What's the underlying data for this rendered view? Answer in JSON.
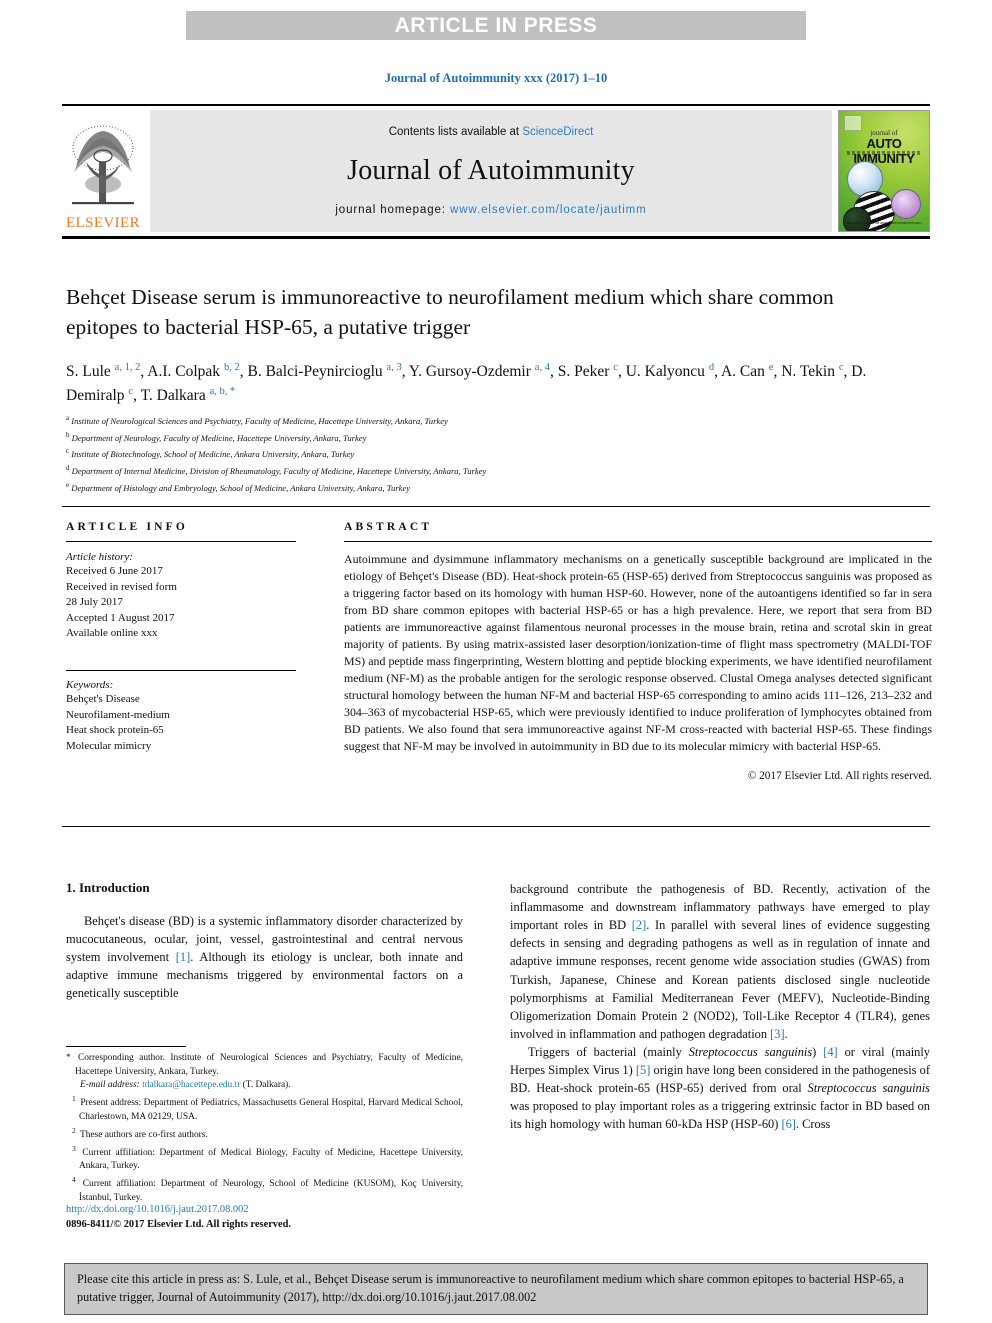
{
  "banner": {
    "text": "ARTICLE IN PRESS"
  },
  "journal_line": "Journal of Autoimmunity xxx (2017) 1–10",
  "masthead": {
    "publisher": "ELSEVIER",
    "contents_prefix": "Contents lists available at ",
    "contents_link": "ScienceDirect",
    "journal_title": "Journal of Autoimmunity",
    "homepage_prefix": "journal homepage: ",
    "homepage_url": "www.elsevier.com/locate/jautimm",
    "cover": {
      "journal_of": "journal of",
      "name": "AUTO IMMUNITY",
      "footer": "Available online at\nwww.sciencedirect.com"
    }
  },
  "article": {
    "title": "Behçet Disease serum is immunoreactive to neurofilament medium which share common epitopes to bacterial HSP-65, a putative trigger",
    "authors_html": "S. Lule <sup>a, 1, 2</sup>, A.I. Colpak <sup>b, 2</sup>, B. Balci-Peynircioglu <sup>a, 3</sup>, Y. Gursoy-Ozdemir <sup>a, 4</sup>, S. Peker <sup>c</sup>, U. Kalyoncu <sup>d</sup>, A. Can <sup>e</sup>, N. Tekin <sup>c</sup>, D. Demiralp <sup>c</sup>, T. Dalkara <sup>a, b, *</sup>",
    "affiliations": [
      {
        "mark": "a",
        "text": "Institute of Neurological Sciences and Psychiatry, Faculty of Medicine, Hacettepe University, Ankara, Turkey"
      },
      {
        "mark": "b",
        "text": "Department of Neurology, Faculty of Medicine, Hacettepe University, Ankara, Turkey"
      },
      {
        "mark": "c",
        "text": "Institute of Biotechnology, School of Medicine, Ankara University, Ankara, Turkey"
      },
      {
        "mark": "d",
        "text": "Department of Internal Medicine, Division of Rheumatology, Faculty of Medicine, Hacettepe University, Ankara, Turkey"
      },
      {
        "mark": "e",
        "text": "Department of Histology and Embryology, School of Medicine, Ankara University, Ankara, Turkey"
      }
    ]
  },
  "article_info": {
    "heading": "ARTICLE INFO",
    "history_label": "Article history:",
    "history": [
      "Received 6 June 2017",
      "Received in revised form",
      "28 July 2017",
      "Accepted 1 August 2017",
      "Available online xxx"
    ],
    "keywords_label": "Keywords:",
    "keywords": [
      "Behçet's Disease",
      "Neurofilament-medium",
      "Heat shock protein-65",
      "Molecular mimicry"
    ]
  },
  "abstract": {
    "heading": "ABSTRACT",
    "body": "Autoimmune and dysimmune inflammatory mechanisms on a genetically susceptible background are implicated in the etiology of Behçet's Disease (BD). Heat-shock protein-65 (HSP-65) derived from Streptococcus sanguinis was proposed as a triggering factor based on its homology with human HSP-60. However, none of the autoantigens identified so far in sera from BD share common epitopes with bacterial HSP-65 or has a high prevalence. Here, we report that sera from BD patients are immunoreactive against filamentous neuronal processes in the mouse brain, retina and scrotal skin in great majority of patients. By using matrix-assisted laser desorption/ionization-time of flight mass spectrometry (MALDI-TOF MS) and peptide mass fingerprinting, Western blotting and peptide blocking experiments, we have identified neurofilament medium (NF-M) as the probable antigen for the serologic response observed. Clustal Omega analyses detected significant structural homology between the human NF-M and bacterial HSP-65 corresponding to amino acids 111–126, 213–232 and 304–363 of mycobacterial HSP-65, which were previously identified to induce proliferation of lymphocytes obtained from BD patients. We also found that sera immunoreactive against NF-M cross-reacted with bacterial HSP-65. These findings suggest that NF-M may be involved in autoimmunity in BD due to its molecular mimicry with bacterial HSP-65.",
    "copyright": "© 2017 Elsevier Ltd. All rights reserved."
  },
  "introduction": {
    "heading": "1. Introduction",
    "left_para_html": "Behçet's disease (BD) is a systemic inflammatory disorder characterized by mucocutaneous, ocular, joint, vessel, gastrointestinal and central nervous system involvement <span class=\"ref\">[1]</span>. Although its etiology is unclear, both innate and adaptive immune mechanisms triggered by environmental factors on a genetically susceptible",
    "right_para1_html": "background contribute the pathogenesis of BD. Recently, activation of the inflammasome and downstream inflammatory pathways have emerged to play important roles in BD <span class=\"ref\">[2]</span>. In parallel with several lines of evidence suggesting defects in sensing and degrading pathogens as well as in regulation of innate and adaptive immune responses, recent genome wide association studies (GWAS) from Turkish, Japanese, Chinese and Korean patients disclosed single nucleotide polymorphisms at Familial Mediterranean Fever (MEFV), Nucleotide-Binding Oligomerization Domain Protein 2 (NOD2), Toll-Like Receptor 4 (TLR4), genes involved in inflammation and pathogen degradation <span class=\"ref\">[3]</span>.",
    "right_para2_html": "Triggers of bacterial (mainly <span class=\"it\">Streptococcus sanguinis</span>) <span class=\"ref\">[4]</span> or viral (mainly Herpes Simplex Virus 1) <span class=\"ref\">[5]</span> origin have long been considered in the pathogenesis of BD. Heat-shock protein-65 (HSP-65) derived from oral <span class=\"it\">Streptococcus sanguinis</span> was proposed to play important roles as a triggering extrinsic factor in BD based on its high homology with human 60-kDa HSP (HSP-60) <span class=\"ref\">[6]</span>. Cross"
  },
  "footnotes": {
    "corresponding_html": "<span class=\"mk mk-star\">*</span> Corresponding author. Institute of Neurological Sciences and Psychiatry, Faculty of Medicine, Hacettepe University, Ankara, Turkey.",
    "email_html": "<span class=\"em\">E-mail address:</span> <span class=\"link\">tdalkara@hacettepe.edu.tr</span> (T. Dalkara).",
    "items_html": [
      "<span class=\"mk\">1</span> Present address: Department of Pediatrics, Massachusetts General Hospital, Harvard Medical School, Charlestown, MA 02129, USA.",
      "<span class=\"mk\">2</span> These authors are co-first authors.",
      "<span class=\"mk\">3</span> Current affiliation: Department of Medical Biology, Faculty of Medicine, Hacettepe University, Ankara, Turkey.",
      "<span class=\"mk\">4</span> Current affiliation: Department of Neurology, School of Medicine (KUSOM), Koç University, İstanbul, Turkey."
    ]
  },
  "doi_block": {
    "doi": "http://dx.doi.org/10.1016/j.jaut.2017.08.002",
    "issn": "0896-8411/© 2017 Elsevier Ltd. All rights reserved."
  },
  "citation_footer": {
    "text": "Please cite this article in press as: S. Lule, et al., Behçet Disease serum is immunoreactive to neurofilament medium which share common epitopes to bacterial HSP-65, a putative trigger, Journal of Autoimmunity (2017), http://dx.doi.org/10.1016/j.jaut.2017.08.002"
  },
  "colors": {
    "link": "#1f7ab0",
    "banner_bg": "#bfc0c2",
    "masthead_bg": "#e6e6e6",
    "elsevier_orange": "#e87722",
    "cite_box_bg": "#c9c9c9"
  }
}
